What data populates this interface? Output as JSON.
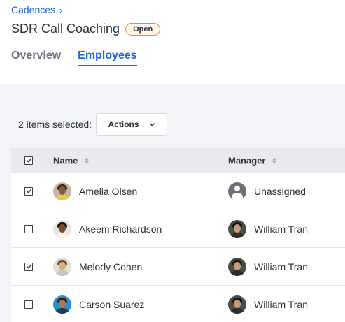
{
  "breadcrumb": {
    "label": "Cadences",
    "separator": "›"
  },
  "page": {
    "title": "SDR Call Coaching",
    "status": "Open"
  },
  "tabs": [
    {
      "label": "Overview",
      "active": false
    },
    {
      "label": "Employees",
      "active": true
    }
  ],
  "selection": {
    "text": "2 items selected:",
    "actions_label": "Actions"
  },
  "table": {
    "columns": [
      "Name",
      "Manager"
    ],
    "rows": [
      {
        "checked": true,
        "name": "Amelia Olsen",
        "manager": "Unassigned"
      },
      {
        "checked": false,
        "name": "Akeem Richardson",
        "manager": "William Tran"
      },
      {
        "checked": true,
        "name": "Melody Cohen",
        "manager": "William Tran"
      },
      {
        "checked": false,
        "name": "Carson Suarez",
        "manager": "William Tran"
      }
    ]
  },
  "colors": {
    "accent": "#1f64d6",
    "badge_border": "#f08a3a",
    "content_bg": "#f3f4f7",
    "header_row_bg": "#e8eaf0"
  }
}
